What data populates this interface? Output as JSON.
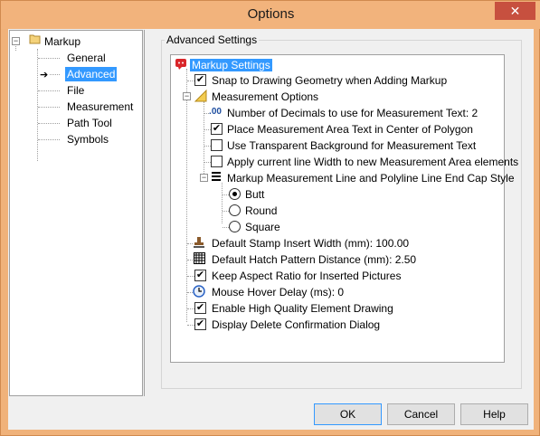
{
  "window": {
    "title": "Options",
    "close_glyph": "✕"
  },
  "tree": {
    "root_label": "Markup",
    "root_expander": "−",
    "items": [
      {
        "label": "General"
      },
      {
        "label": "Advanced",
        "selected": true
      },
      {
        "label": "File"
      },
      {
        "label": "Measurement"
      },
      {
        "label": "Path Tool"
      },
      {
        "label": "Symbols"
      }
    ]
  },
  "settings": {
    "group_label": "Advanced Settings",
    "root_label": "Markup Settings",
    "snap": {
      "label": "Snap to Drawing Geometry when Adding Markup",
      "checked": true
    },
    "measurement_options": {
      "label": "Measurement Options",
      "decimals": {
        "icon_text": ".00",
        "label": "Number of Decimals to use for Measurement Text: 2"
      },
      "place_text": {
        "label": "Place Measurement Area Text in Center of Polygon",
        "checked": true
      },
      "transparent_bg": {
        "label": "Use Transparent Background for Measurement Text",
        "checked": false
      },
      "line_width": {
        "label": "Apply current line Width to new Measurement Area elements",
        "checked": false
      },
      "end_cap": {
        "label": "Markup Measurement Line and Polyline Line End Cap Style",
        "options": [
          {
            "label": "Butt",
            "selected": true
          },
          {
            "label": "Round",
            "selected": false
          },
          {
            "label": "Square",
            "selected": false
          }
        ]
      }
    },
    "stamp_width": {
      "label": "Default Stamp Insert Width (mm): 100.00"
    },
    "hatch_distance": {
      "label": "Default Hatch Pattern Distance (mm): 2.50"
    },
    "aspect_ratio": {
      "label": "Keep Aspect Ratio for Inserted Pictures",
      "checked": true
    },
    "hover_delay": {
      "label": "Mouse Hover Delay (ms): 0"
    },
    "high_quality": {
      "label": "Enable High Quality Element Drawing",
      "checked": true
    },
    "delete_confirm": {
      "label": "Display Delete Confirmation Dialog",
      "checked": true
    }
  },
  "buttons": {
    "ok": "OK",
    "cancel": "Cancel",
    "help": "Help"
  },
  "colors": {
    "title_bar": "#f2b37c",
    "close": "#c7503f",
    "selection": "#3399ff"
  }
}
